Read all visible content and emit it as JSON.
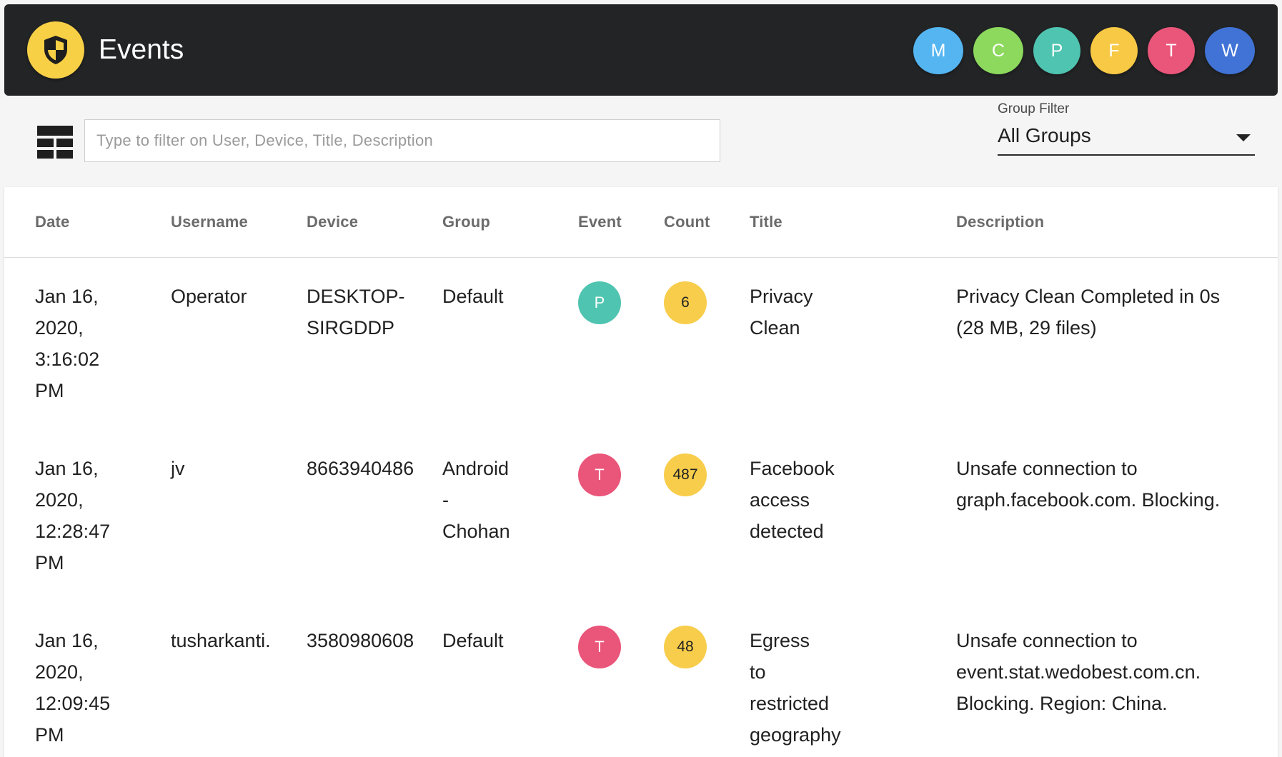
{
  "header": {
    "title": "Events",
    "logo_icon": "shield-icon",
    "colors": {
      "bar": "#232426",
      "logo": "#f7d046"
    },
    "avatars": [
      {
        "letter": "M",
        "color": "#54b5f0"
      },
      {
        "letter": "C",
        "color": "#8cd95e"
      },
      {
        "letter": "P",
        "color": "#4fc4b0"
      },
      {
        "letter": "F",
        "color": "#f7c944"
      },
      {
        "letter": "T",
        "color": "#ea557a"
      },
      {
        "letter": "W",
        "color": "#4173d6"
      }
    ]
  },
  "toolbar": {
    "view_toggle_icon": "table-view-icon",
    "filter_placeholder": "Type to filter on User, Device, Title, Description",
    "group_filter": {
      "label": "Group Filter",
      "value": "All Groups",
      "icon": "caret-down-icon"
    }
  },
  "table": {
    "columns": [
      "Date",
      "Username",
      "Device",
      "Group",
      "Event",
      "Count",
      "Title",
      "Description"
    ],
    "rows": [
      {
        "date": [
          "Jan 16,",
          "2020,",
          "3:16:02",
          "PM"
        ],
        "username": "Operator",
        "device": [
          "DESKTOP-",
          "SIRGDDP"
        ],
        "group": [
          "Default"
        ],
        "event": {
          "letter": "P",
          "color": "#4fc4b0"
        },
        "count": "6",
        "title": [
          "Privacy",
          "Clean"
        ],
        "description": [
          "Privacy Clean Completed in 0s",
          "(28 MB, 29 files)"
        ]
      },
      {
        "date": [
          "Jan 16,",
          "2020,",
          "12:28:47",
          "PM"
        ],
        "username": "jv",
        "device": [
          "8663940486"
        ],
        "group": [
          "Android",
          "-",
          "Chohan"
        ],
        "event": {
          "letter": "T",
          "color": "#ea557a"
        },
        "count": "487",
        "title": [
          "Facebook",
          "access",
          "detected"
        ],
        "description": [
          "Unsafe connection to",
          "graph.facebook.com. Blocking."
        ]
      },
      {
        "date": [
          "Jan 16,",
          "2020,",
          "12:09:45",
          "PM"
        ],
        "username": "tusharkanti.",
        "device": [
          "3580980608"
        ],
        "group": [
          "Default"
        ],
        "event": {
          "letter": "T",
          "color": "#ea557a"
        },
        "count": "48",
        "title": [
          "Egress",
          "to",
          "restricted",
          "geography"
        ],
        "description": [
          "Unsafe connection to",
          "event.stat.wedobest.com.cn.",
          "Blocking. Region: China."
        ]
      }
    ]
  }
}
